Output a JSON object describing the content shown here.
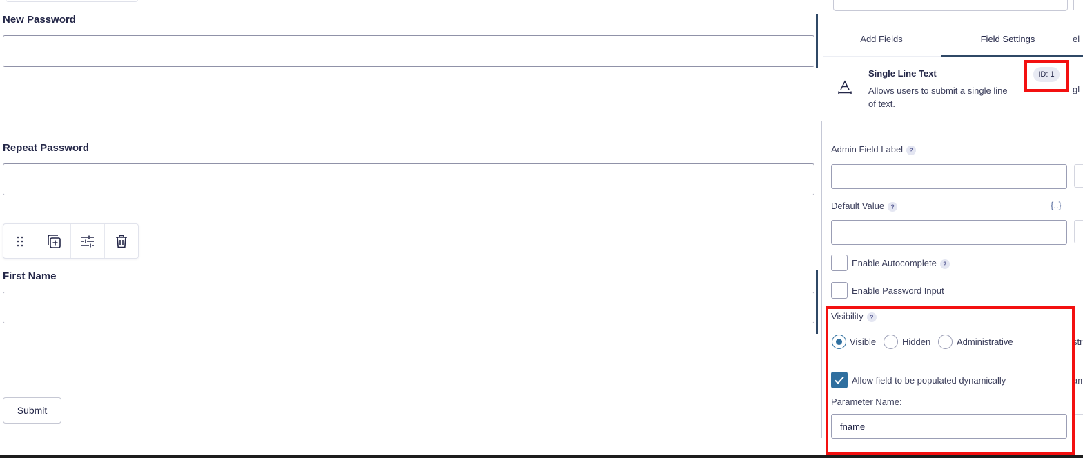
{
  "form": {
    "fields": [
      {
        "label": "New Password",
        "value": ""
      },
      {
        "label": "Repeat Password",
        "value": ""
      },
      {
        "label": "First Name",
        "value": ""
      }
    ],
    "toolbar": {
      "drag_icon": "drag-handle-icon",
      "duplicate_icon": "duplicate-icon",
      "settings_icon": "sliders-icon",
      "delete_icon": "trash-icon"
    },
    "submit_label": "Submit"
  },
  "panel": {
    "tabs": [
      {
        "label": "Add Fields"
      },
      {
        "label": "Field Settings",
        "active": true
      },
      {
        "label": "el"
      }
    ],
    "field_info": {
      "icon": "text-field-icon",
      "title": "Single Line Text",
      "description": "Allows users to submit a single line of text.",
      "id_badge": "ID: 1",
      "clipped_text": "gl"
    },
    "settings": {
      "admin_label": {
        "label": "Admin Field Label",
        "help": "?",
        "value": ""
      },
      "default_value": {
        "label": "Default Value",
        "help": "?",
        "merge_tag": "{..}",
        "value": ""
      },
      "enable_autocomplete": {
        "label": "Enable Autocomplete",
        "help": "?",
        "checked": false
      },
      "enable_password_input": {
        "label": "Enable Password Input",
        "checked": false
      },
      "visibility": {
        "label": "Visibility",
        "help": "?",
        "options": [
          {
            "label": "Visible",
            "checked": true
          },
          {
            "label": "Hidden",
            "checked": false
          },
          {
            "label": "Administrative",
            "checked": false
          }
        ],
        "clipped_text": "str"
      },
      "populate_dynamically": {
        "label": "Allow field to be populated dynamically",
        "checked": true,
        "clipped_text": "am"
      },
      "parameter_name": {
        "label": "Parameter Name:",
        "value": "fname"
      }
    }
  },
  "colors": {
    "accent": "#2f6f9f",
    "focus_bar": "#2f4866",
    "highlight": "#f31010"
  }
}
